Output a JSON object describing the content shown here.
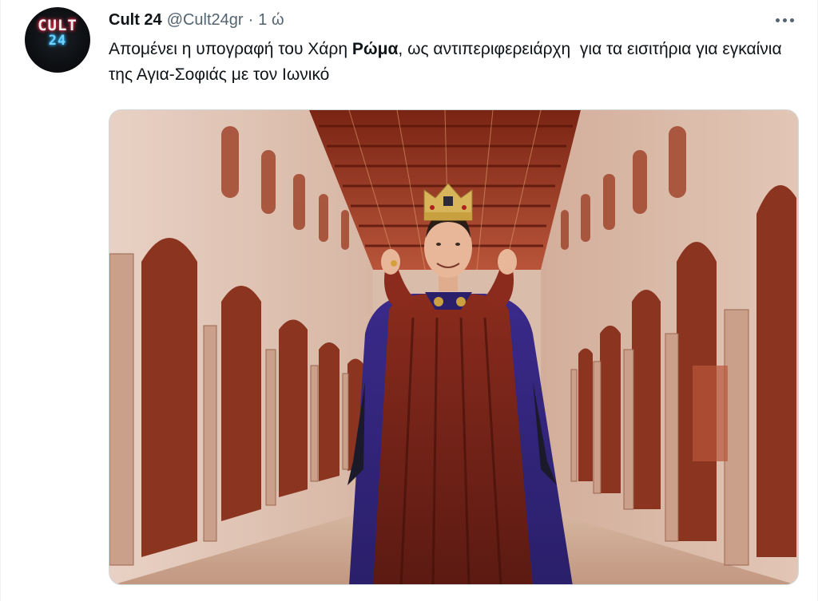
{
  "tweet": {
    "display_name": "Cult 24",
    "handle": "@Cult24gr",
    "separator": "·",
    "timestamp": "1 ώ",
    "text_part1": "Απομένει η υπογραφή του Χάρη ",
    "text_bold": "Ρώμα",
    "text_part2": ", ως αντιπεριφερειάρχη  για τα εισιτήρια για εγκαίνια της Αγια-Σοφιάς με τον Ιωνικό"
  },
  "avatar": {
    "line1": "CULT",
    "line2": "24"
  },
  "icons": {
    "more": "more-horizontal-icon"
  },
  "colors": {
    "text": "#0f1419",
    "secondary": "#536471",
    "border": "#eff3f4"
  }
}
